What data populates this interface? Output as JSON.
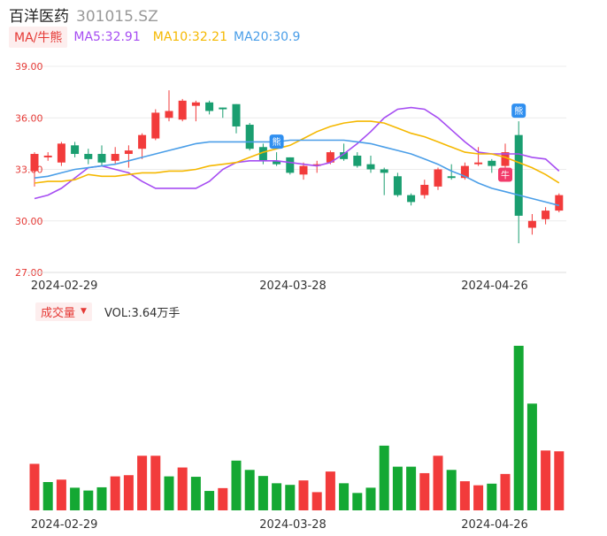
{
  "header": {
    "name": "百洋医药",
    "code": "301015.SZ"
  },
  "legend": {
    "ma_tag": "MA/牛熊",
    "ma5": "MA5:32.91",
    "ma10": "MA10:32.21",
    "ma20": "MA20:30.9"
  },
  "volume_panel": {
    "tag": "成交量",
    "value_text": "VOL:3.64万手"
  },
  "colors": {
    "up": "#f23b3b",
    "down": "#1a9e70",
    "vol_up": "#f23b3b",
    "vol_down": "#14a833",
    "ma5": "#a64df2",
    "ma10": "#f5b800",
    "ma20": "#4a9ee8",
    "tag_bg": "#fdeeee",
    "tag_text": "#e53935"
  },
  "chart_data": [
    {
      "type": "candlestick",
      "title": "",
      "ylim": [
        27,
        39
      ],
      "y_ticks": [
        "39.00",
        "36.00",
        "33.00",
        "30.00",
        "27.00"
      ],
      "x_tick_labels": [
        {
          "index": 3,
          "label": "2024-02-29"
        },
        {
          "index": 20,
          "label": "2024-03-28"
        },
        {
          "index": 35,
          "label": "2024-04-26"
        }
      ],
      "candles": [
        {
          "o": 32.9,
          "c": 33.9,
          "h": 34.0,
          "l": 32.0
        },
        {
          "o": 33.7,
          "c": 33.8,
          "h": 34.0,
          "l": 33.5
        },
        {
          "o": 33.4,
          "c": 34.5,
          "h": 34.6,
          "l": 33.2
        },
        {
          "o": 34.4,
          "c": 33.9,
          "h": 34.6,
          "l": 33.7
        },
        {
          "o": 33.9,
          "c": 33.6,
          "h": 34.2,
          "l": 33.3
        },
        {
          "o": 33.9,
          "c": 33.4,
          "h": 34.4,
          "l": 33.2
        },
        {
          "o": 33.5,
          "c": 33.9,
          "h": 34.3,
          "l": 33.3
        },
        {
          "o": 33.9,
          "c": 34.1,
          "h": 34.4,
          "l": 33.1
        },
        {
          "o": 34.2,
          "c": 35.0,
          "h": 35.1,
          "l": 33.6
        },
        {
          "o": 34.8,
          "c": 36.3,
          "h": 36.5,
          "l": 34.7
        },
        {
          "o": 36.0,
          "c": 36.4,
          "h": 37.6,
          "l": 35.8
        },
        {
          "o": 35.9,
          "c": 37.0,
          "h": 37.1,
          "l": 35.8
        },
        {
          "o": 36.7,
          "c": 36.9,
          "h": 37.0,
          "l": 35.8
        },
        {
          "o": 36.9,
          "c": 36.4,
          "h": 37.0,
          "l": 36.2
        },
        {
          "o": 36.6,
          "c": 36.5,
          "h": 36.6,
          "l": 36.0
        },
        {
          "o": 36.8,
          "c": 35.5,
          "h": 36.8,
          "l": 35.1
        },
        {
          "o": 35.6,
          "c": 34.2,
          "h": 35.7,
          "l": 34.1
        },
        {
          "o": 34.3,
          "c": 33.5,
          "h": 34.5,
          "l": 33.3
        },
        {
          "o": 33.5,
          "c": 33.3,
          "h": 34.0,
          "l": 33.2
        },
        {
          "o": 33.7,
          "c": 32.8,
          "h": 33.7,
          "l": 32.7
        },
        {
          "o": 32.7,
          "c": 33.2,
          "h": 33.4,
          "l": 32.4
        },
        {
          "o": 33.2,
          "c": 33.3,
          "h": 33.5,
          "l": 32.8
        },
        {
          "o": 33.4,
          "c": 34.0,
          "h": 34.1,
          "l": 33.3
        },
        {
          "o": 34.0,
          "c": 33.6,
          "h": 34.5,
          "l": 33.5
        },
        {
          "o": 33.8,
          "c": 33.2,
          "h": 34.0,
          "l": 33.1
        },
        {
          "o": 33.3,
          "c": 33.0,
          "h": 33.8,
          "l": 32.8
        },
        {
          "o": 33.0,
          "c": 32.8,
          "h": 33.1,
          "l": 31.5
        },
        {
          "o": 32.6,
          "c": 31.5,
          "h": 32.8,
          "l": 31.4
        },
        {
          "o": 31.5,
          "c": 31.1,
          "h": 31.6,
          "l": 30.9
        },
        {
          "o": 31.5,
          "c": 32.1,
          "h": 32.4,
          "l": 31.3
        },
        {
          "o": 32.0,
          "c": 33.0,
          "h": 33.1,
          "l": 31.8
        },
        {
          "o": 32.6,
          "c": 32.5,
          "h": 33.3,
          "l": 32.4
        },
        {
          "o": 32.5,
          "c": 33.2,
          "h": 33.4,
          "l": 32.4
        },
        {
          "o": 33.3,
          "c": 33.4,
          "h": 34.3,
          "l": 33.2
        },
        {
          "o": 33.5,
          "c": 33.2,
          "h": 33.6,
          "l": 32.8
        },
        {
          "o": 33.2,
          "c": 34.0,
          "h": 34.5,
          "l": 33.1
        },
        {
          "o": 35.0,
          "c": 30.3,
          "h": 35.8,
          "l": 28.7
        },
        {
          "o": 29.6,
          "c": 30.0,
          "h": 30.4,
          "l": 29.2
        },
        {
          "o": 30.1,
          "c": 30.6,
          "h": 30.8,
          "l": 29.8
        },
        {
          "o": 30.6,
          "c": 31.5,
          "h": 31.6,
          "l": 30.5
        }
      ],
      "series": [
        {
          "name": "MA5",
          "values": [
            31.3,
            31.5,
            31.9,
            32.5,
            33.1,
            33.2,
            33.0,
            32.8,
            32.3,
            31.9,
            31.9,
            31.9,
            31.9,
            32.3,
            33.0,
            33.4,
            33.5,
            33.5,
            33.5,
            33.4,
            33.3,
            33.2,
            33.4,
            33.9,
            34.5,
            35.2,
            36.0,
            36.5,
            36.6,
            36.5,
            36.0,
            35.3,
            34.6,
            34.0,
            33.9,
            33.9,
            33.9,
            33.7,
            33.6,
            32.9
          ]
        },
        {
          "name": "MA10",
          "values": [
            32.2,
            32.3,
            32.3,
            32.4,
            32.7,
            32.6,
            32.6,
            32.7,
            32.8,
            32.8,
            32.9,
            32.9,
            33.0,
            33.2,
            33.3,
            33.4,
            33.7,
            34.0,
            34.2,
            34.4,
            34.8,
            35.2,
            35.5,
            35.7,
            35.8,
            35.8,
            35.7,
            35.4,
            35.1,
            34.9,
            34.6,
            34.3,
            34.0,
            33.9,
            33.9,
            33.7,
            33.4,
            33.1,
            32.7,
            32.21
          ]
        },
        {
          "name": "MA20",
          "values": [
            32.5,
            32.6,
            32.8,
            33.0,
            33.1,
            33.2,
            33.3,
            33.5,
            33.7,
            33.9,
            34.1,
            34.3,
            34.5,
            34.6,
            34.6,
            34.6,
            34.6,
            34.6,
            34.6,
            34.7,
            34.7,
            34.7,
            34.7,
            34.7,
            34.6,
            34.5,
            34.3,
            34.1,
            33.9,
            33.6,
            33.3,
            32.9,
            32.6,
            32.2,
            31.9,
            31.7,
            31.5,
            31.3,
            31.1,
            30.9
          ]
        }
      ],
      "markers": [
        {
          "index": 18,
          "kind": "bear",
          "glyph": "熊"
        },
        {
          "index": 36,
          "kind": "bear",
          "glyph": "熊"
        },
        {
          "index": 35,
          "kind": "bull",
          "glyph": "牛"
        }
      ]
    },
    {
      "type": "bar",
      "title": "",
      "ylim": [
        0,
        4.2
      ],
      "x_tick_labels": [
        {
          "index": 3,
          "label": "2024-02-29"
        },
        {
          "index": 20,
          "label": "2024-03-28"
        },
        {
          "index": 35,
          "label": "2024-04-26"
        }
      ],
      "values": [
        1.15,
        0.7,
        0.76,
        0.56,
        0.49,
        0.57,
        0.84,
        0.87,
        1.35,
        1.35,
        0.84,
        1.06,
        0.83,
        0.48,
        0.55,
        1.23,
        1.0,
        0.85,
        0.67,
        0.63,
        0.74,
        0.45,
        0.96,
        0.67,
        0.43,
        0.56,
        1.6,
        1.08,
        1.08,
        0.92,
        1.35,
        1.0,
        0.72,
        0.62,
        0.66,
        0.9,
        4.07,
        2.64,
        1.48,
        1.46
      ],
      "up_flags": [
        true,
        false,
        true,
        false,
        false,
        false,
        true,
        true,
        true,
        true,
        false,
        true,
        false,
        false,
        true,
        false,
        false,
        false,
        false,
        false,
        true,
        true,
        true,
        false,
        false,
        false,
        false,
        false,
        false,
        true,
        true,
        false,
        true,
        true,
        false,
        true,
        false,
        false,
        true,
        true
      ]
    }
  ]
}
